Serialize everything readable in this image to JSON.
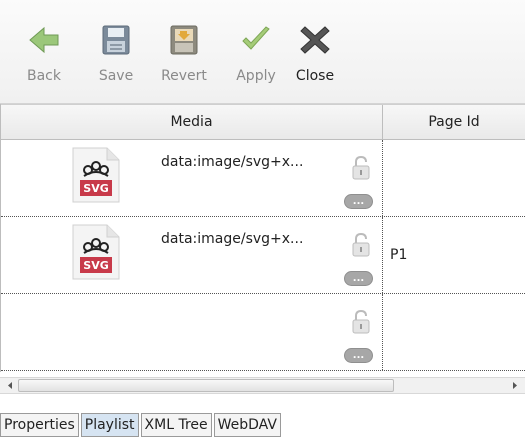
{
  "toolbar": {
    "buttons": [
      {
        "id": "back",
        "label": "Back",
        "icon": "back-arrow-icon",
        "enabled": false
      },
      {
        "id": "save",
        "label": "Save",
        "icon": "floppy-disk-icon",
        "enabled": false
      },
      {
        "id": "revert",
        "label": "Revert",
        "icon": "revert-disk-icon",
        "enabled": false
      },
      {
        "id": "apply",
        "label": "Apply",
        "icon": "checkmark-icon",
        "enabled": false
      },
      {
        "id": "close",
        "label": "Close",
        "icon": "close-x-icon",
        "enabled": true
      }
    ]
  },
  "table": {
    "columns": [
      "Media",
      "Page Id"
    ],
    "rows": [
      {
        "media": "data:image/svg+x...",
        "page_id": "",
        "has_thumbnail": true
      },
      {
        "media": "data:image/svg+x...",
        "page_id": "P1",
        "has_thumbnail": true
      },
      {
        "media": "",
        "page_id": "",
        "has_thumbnail": false
      }
    ],
    "thumbnail_badge": "SVG",
    "more_button_label": "..."
  },
  "tabs": [
    {
      "label": "Properties",
      "active": false
    },
    {
      "label": "Playlist",
      "active": true
    },
    {
      "label": "XML Tree",
      "active": false
    },
    {
      "label": "WebDAV",
      "active": false
    }
  ],
  "colors": {
    "back_arrow": "#8fbf6a",
    "apply_check": "#9cc46a",
    "close_x": "#4a4a4a",
    "svg_badge": "#c83a4a",
    "active_tab": "#d6e4f2"
  }
}
